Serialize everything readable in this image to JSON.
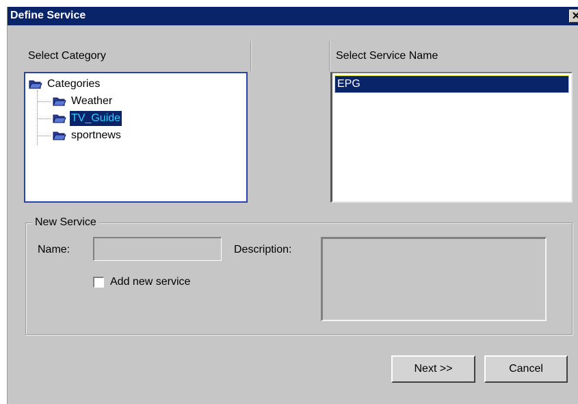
{
  "window": {
    "title": "Define Service",
    "close_glyph": "✕"
  },
  "category_panel": {
    "header": "Select Category",
    "tree": {
      "root": {
        "label": "Categories",
        "icon": "folder-icon"
      },
      "children": [
        {
          "label": "Weather",
          "selected": false
        },
        {
          "label": "TV_Guide",
          "selected": true
        },
        {
          "label": "sportnews",
          "selected": false
        }
      ]
    }
  },
  "service_panel": {
    "header": "Select Service Name",
    "items": [
      {
        "label": "EPG",
        "selected": true
      }
    ]
  },
  "new_service": {
    "group_title": "New Service",
    "name_label": "Name:",
    "name_value": "",
    "description_label": "Description:",
    "description_value": "",
    "add_checkbox_label": "Add new service",
    "add_checked": false
  },
  "buttons": {
    "next": "Next >>",
    "cancel": "Cancel"
  },
  "colors": {
    "titlebar": "#0a246a",
    "selection": "#0a246a",
    "selection_text": "#33ccff",
    "tree_border": "#2542b0",
    "face": "#c6c6c6"
  }
}
